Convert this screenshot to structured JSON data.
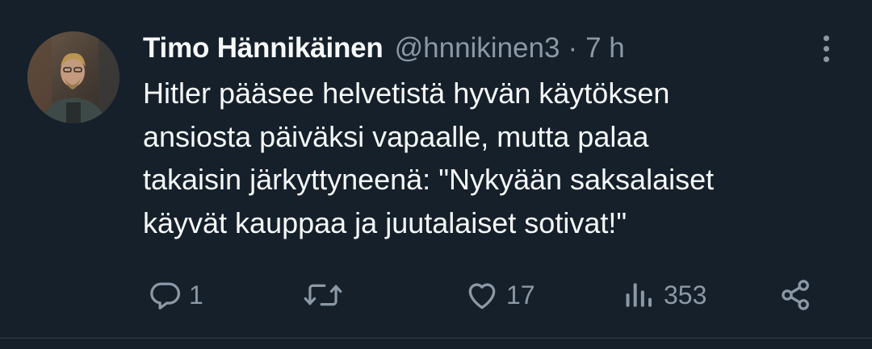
{
  "tweet": {
    "author": {
      "display_name": "Timo Hännikäinen",
      "handle": "@hnnikinen3",
      "separator": "·",
      "time": "7 h"
    },
    "text_lines": [
      "Hitler pääsee helvetistä hyvän käytöksen",
      "ansiosta päiväksi vapaalle, mutta palaa",
      "takaisin järkyttyneenä: \"Nykyään saksalaiset",
      "käyvät kauppaa ja juutalaiset sotivat!\""
    ],
    "actions": {
      "reply": {
        "icon": "reply-icon",
        "count": "1"
      },
      "retweet": {
        "icon": "retweet-icon",
        "count": ""
      },
      "like": {
        "icon": "heart-icon",
        "count": "17"
      },
      "views": {
        "icon": "views-icon",
        "count": "353"
      },
      "share": {
        "icon": "share-icon"
      }
    }
  },
  "colors": {
    "background": "#15202b",
    "primary_text": "#f7f9f9",
    "secondary_text": "#8b98a5",
    "divider": "#2f3b47"
  }
}
